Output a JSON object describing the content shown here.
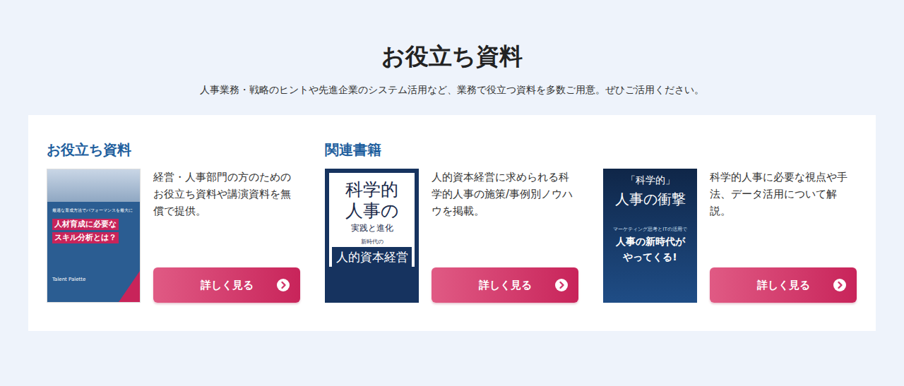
{
  "page": {
    "title": "お役立ち資料",
    "subtitle": "人事業務・戦略のヒントや先進企業のシステム活用など、業務で役立つ資料を多数ご用意。ぜひご活用ください。"
  },
  "items": [
    {
      "heading": "お役立ち資料",
      "description": "経営・人事部門の方のためのお役立ち資料や講演資料を無償で提供。",
      "button": "詳しく見る",
      "cover": {
        "kind": "doc",
        "lines": [
          {
            "text": "最適な育成方法でパフォーマンスを最大に",
            "kind": "small"
          },
          {
            "text": "人材育成に必要な",
            "kind": "lead"
          },
          {
            "text": "スキル分析とは？",
            "kind": "lead"
          },
          {
            "text": "Talent Palette",
            "kind": "logo"
          }
        ]
      }
    },
    {
      "heading": "関連書籍",
      "description": "人的資本経営に求められる科学的人事の施策/事例別ノウハウを掲載。",
      "button": "詳しく見る",
      "cover": {
        "kind": "book-light",
        "lines": [
          {
            "text": "科学的",
            "kind": "big"
          },
          {
            "text": "人事の",
            "kind": "big"
          },
          {
            "text": "実践と進化",
            "kind": "mid"
          },
          {
            "text": "新時代の",
            "kind": "small"
          },
          {
            "text": "人的資本経営",
            "kind": "band"
          }
        ]
      }
    },
    {
      "description": "科学的人事に必要な視点や手法、データ活用について解説。",
      "button": "詳しく見る",
      "cover": {
        "kind": "book-dark",
        "lines": [
          {
            "text": "「科学的」",
            "kind": "mid"
          },
          {
            "text": "人事の衝撃",
            "kind": "big"
          },
          {
            "text": "マーケティング思考とITの活用で",
            "kind": "small"
          },
          {
            "text": "人事の新時代が",
            "kind": "accent"
          },
          {
            "text": "やってくる!",
            "kind": "accent"
          }
        ]
      }
    }
  ]
}
